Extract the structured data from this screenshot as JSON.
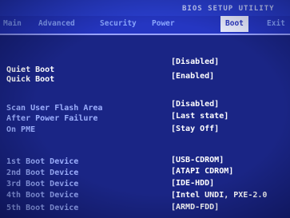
{
  "bios_title": "BIOS SETUP UTILITY",
  "menu": [
    "Main",
    "Advanced",
    "Security",
    "Power",
    "Boot",
    "Exit"
  ],
  "active_menu": "Boot",
  "settings": [
    {
      "label": "Quiet Boot",
      "value": "[Disabled]"
    },
    {
      "label": "Quick Boot",
      "value": "[Enabled]"
    },
    {
      "label": "Scan User Flash Area",
      "value": "[Disabled]"
    },
    {
      "label": "After Power Failure",
      "value": "[Last state]"
    },
    {
      "label": "On PME",
      "value": "[Stay Off]"
    }
  ],
  "boot_devices": [
    {
      "label": "1st Boot Device",
      "value": "[USB-CDROM]"
    },
    {
      "label": "2nd Boot Device",
      "value": "[ATAPI CDROM]"
    },
    {
      "label": "3rd Boot Device",
      "value": "[IDE-HDD]"
    },
    {
      "label": "4th Boot Device",
      "value": "[Intel UNDI, PXE-2.0"
    },
    {
      "label": "5th Boot Device",
      "value": "[ARMD-FDD]"
    }
  ],
  "colors": {
    "background": "#1a2585",
    "menubar": "#2536c2",
    "label_text": "#9db0ff",
    "value_text": "#ffffff",
    "active_tab_bg": "#e9ecff"
  }
}
